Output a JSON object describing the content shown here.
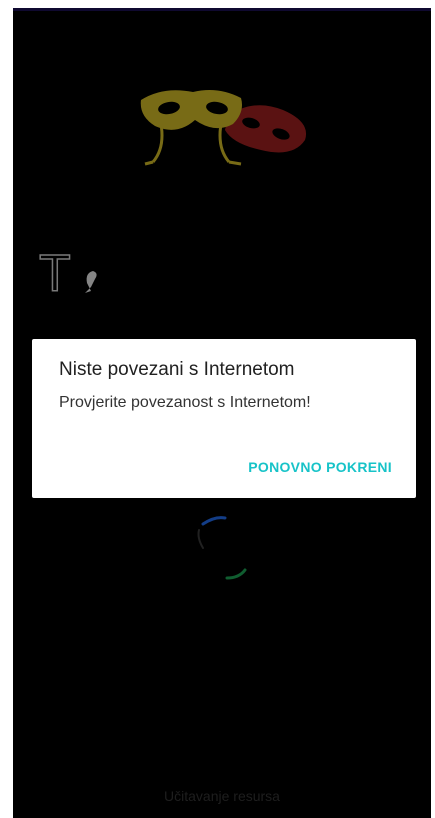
{
  "splash": {
    "background_color": "#000000",
    "masks_icon": "theatre-masks-icon",
    "partial_title_letter": "T",
    "loading_text": "Učitavanje resursa",
    "spinner_colors": [
      "#1e5fd0",
      "#1a8f4a"
    ]
  },
  "dialog": {
    "title": "Niste povezani s Internetom",
    "message": "Provjerite povezanost s Internetom!",
    "action_label": "PONOVNO POKRENI",
    "accent_color": "#17c3c8"
  }
}
